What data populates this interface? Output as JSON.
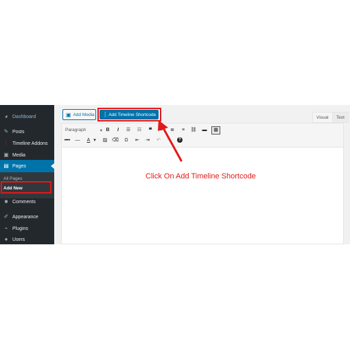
{
  "sidebar": {
    "items": [
      {
        "label": "Dashboard",
        "icon": "dashboard-icon",
        "glyph": "◕"
      },
      {
        "label": "Posts",
        "icon": "pin-icon",
        "glyph": "✎"
      },
      {
        "label": "Timeline Addons",
        "icon": "timeline-icon",
        "glyph": "⋮"
      },
      {
        "label": "Media",
        "icon": "media-icon",
        "glyph": "▣"
      },
      {
        "label": "Pages",
        "icon": "pages-icon",
        "glyph": "▤"
      }
    ],
    "submenu": [
      {
        "label": "All Pages"
      },
      {
        "label": "Add New"
      }
    ],
    "items_after": [
      {
        "label": "Comments",
        "icon": "comments-icon",
        "glyph": "■"
      },
      {
        "label": "Appearance",
        "icon": "brush-icon",
        "glyph": "✐"
      },
      {
        "label": "Plugins",
        "icon": "plugin-icon",
        "glyph": "⌁"
      },
      {
        "label": "Users",
        "icon": "users-icon",
        "glyph": "●"
      }
    ]
  },
  "editor": {
    "add_media_label": "Add Media",
    "add_timeline_label": "Add Timeline Shortcode",
    "tabs": [
      "Visual",
      "Text"
    ],
    "format_select": "Paragraph",
    "toolbar_row1": [
      "B",
      "I",
      "☰",
      "☷",
      "❝",
      "≡",
      "≣",
      "≡",
      "⛓",
      "▬",
      "▦"
    ],
    "toolbar_row2": [
      "ABC",
      "—",
      "A",
      "▾",
      "▨",
      "⌫",
      "Ω",
      "⇤",
      "⇥",
      "↶",
      "↷",
      "?"
    ]
  },
  "annotation": {
    "text": "Click On Add Timeline Shortcode",
    "color": "#e2191b"
  },
  "colors": {
    "sidebar_bg": "#23282d",
    "active": "#0073aa",
    "highlight": "#e2191b"
  }
}
